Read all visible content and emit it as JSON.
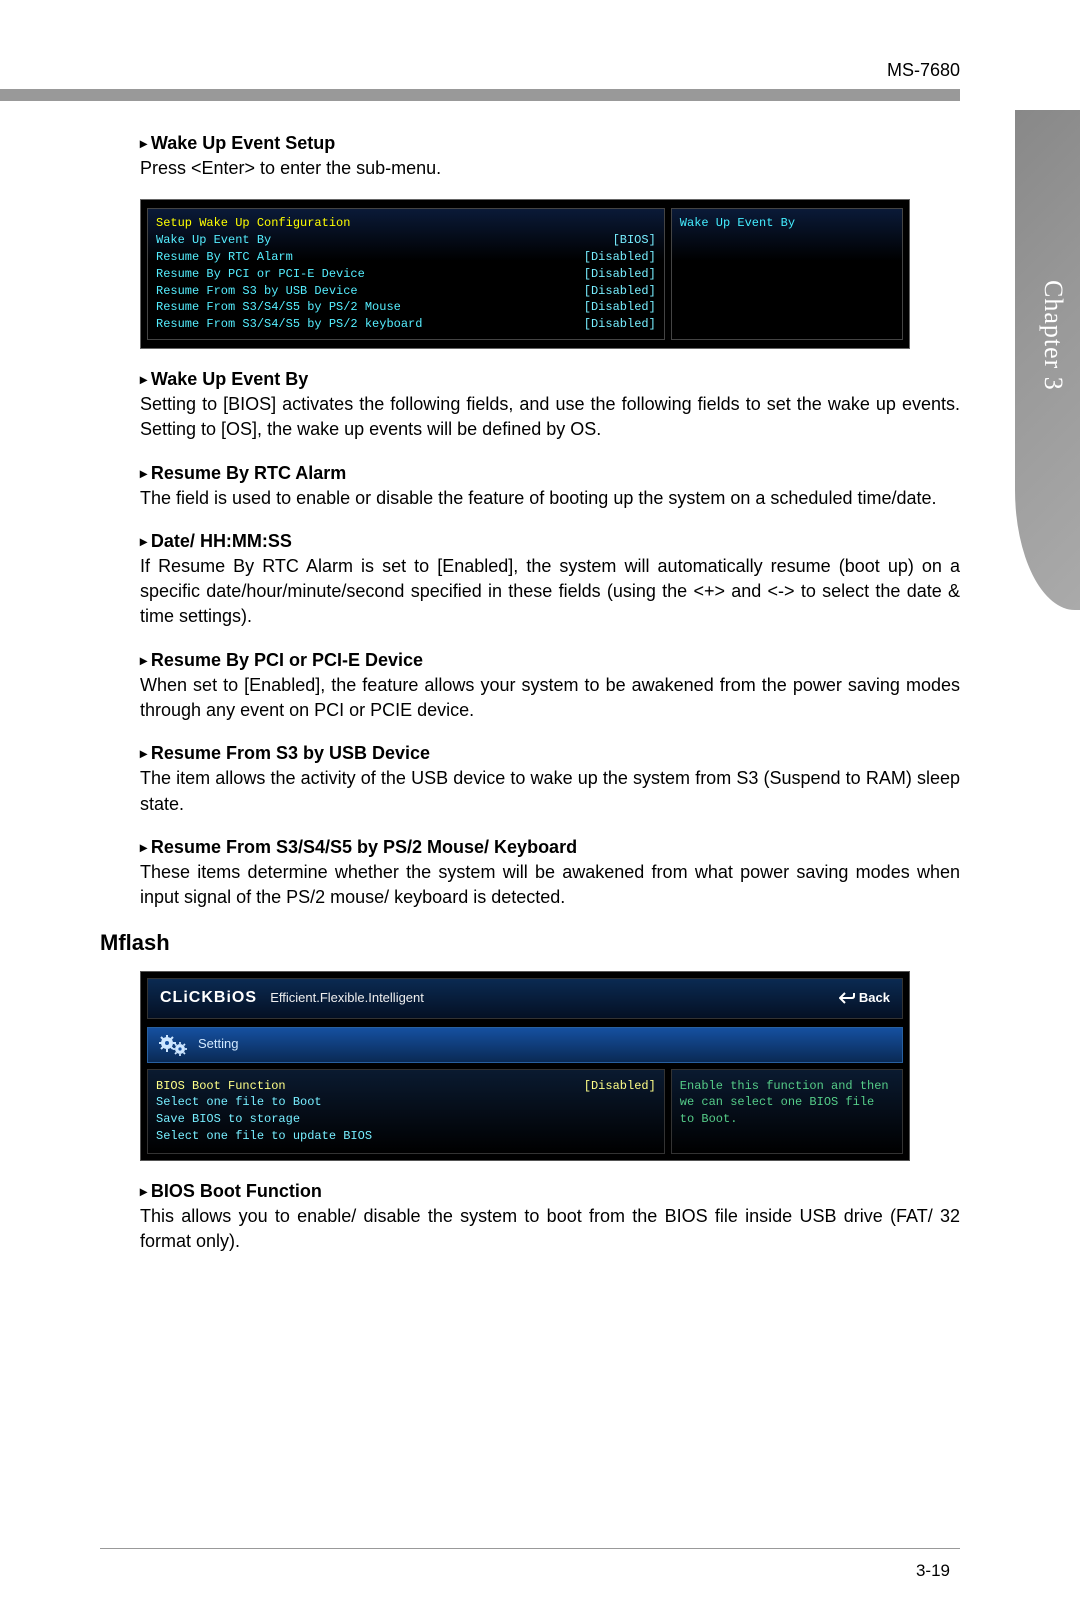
{
  "header": {
    "model": "MS-7680"
  },
  "chapter_tab": "Chapter 3",
  "wake_up_event_setup": {
    "title": "Wake Up Event Setup",
    "body": "Press <Enter> to enter the sub-menu."
  },
  "bios_wake": {
    "config_header": "Setup Wake Up Configuration",
    "rows": [
      {
        "label": "Wake Up Event By",
        "value": "[BIOS]"
      },
      {
        "label": "Resume By RTC Alarm",
        "value": "[Disabled]"
      },
      {
        "label": "Resume By PCI or PCI-E Device",
        "value": "[Disabled]"
      },
      {
        "label": "Resume From S3 by USB Device",
        "value": "[Disabled]"
      },
      {
        "label": "Resume From S3/S4/S5 by PS/2 Mouse",
        "value": "[Disabled]"
      },
      {
        "label": "Resume From S3/S4/S5 by PS/2 keyboard",
        "value": "[Disabled]"
      }
    ],
    "right_panel": "Wake Up Event By"
  },
  "sections": [
    {
      "title": "Wake Up Event By",
      "body": "Setting to [BIOS] activates the following fields, and use the following fields to set the wake up events. Setting to [OS], the wake up events will be defined by OS."
    },
    {
      "title": "Resume By RTC Alarm",
      "body": "The field is used to enable or disable the feature of booting up the system on a scheduled time/date."
    },
    {
      "title": "Date/ HH:MM:SS",
      "body": "If Resume By RTC Alarm is set to [Enabled], the system will automatically resume (boot up) on a specific date/hour/minute/second specified in these fields (using the <+> and <-> to select the date & time settings)."
    },
    {
      "title": "Resume By PCI or PCI-E Device",
      "body": "When set to [Enabled], the feature allows your system to be awakened from the power saving modes through any event on PCI or PCIE device."
    },
    {
      "title": "Resume From S3 by USB Device",
      "body": "The item allows the activity of the USB device to wake up the system from S3 (Suspend to RAM) sleep state."
    },
    {
      "title": "Resume From S3/S4/S5 by PS/2 Mouse/ Keyboard",
      "body": "These items determine whether the system will be awakened from what power saving modes when input signal of the PS/2 mouse/ keyboard is detected."
    }
  ],
  "mflash": {
    "heading": "Mflash",
    "logo": "CLiCKBiOS",
    "tagline": "Efficient.Flexible.Intelligent",
    "back": "Back",
    "setting_tab": "Setting",
    "rows": [
      {
        "label": "BIOS Boot Function",
        "value": "[Disabled]",
        "highlight": true
      },
      {
        "label": "Select one file to Boot",
        "value": "",
        "highlight": false
      },
      {
        "label": "Save BIOS to storage",
        "value": "",
        "highlight": false
      },
      {
        "label": "Select one file to update BIOS",
        "value": "",
        "highlight": false
      }
    ],
    "right_panel": "Enable this function and then we can select one BIOS file to Boot."
  },
  "bios_boot_function": {
    "title": "BIOS Boot Function",
    "body": "This allows you to enable/ disable the system to boot from the BIOS file inside USB drive (FAT/ 32 format only)."
  },
  "page_number": "3-19"
}
